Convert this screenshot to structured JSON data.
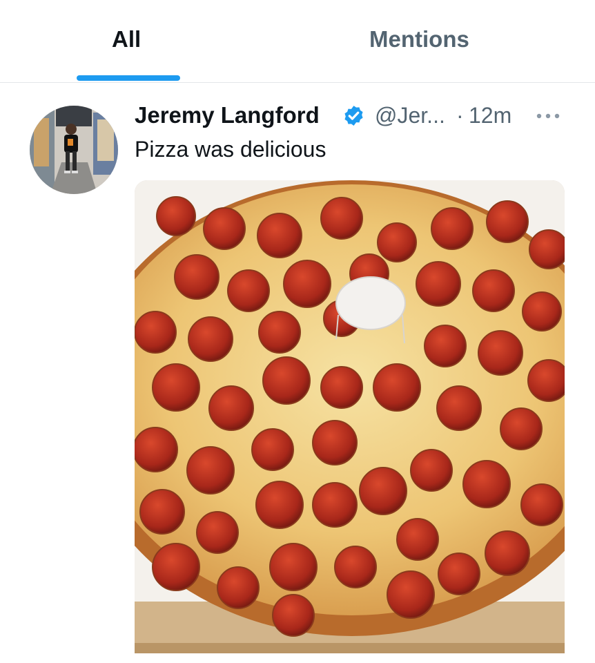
{
  "tabs": {
    "all_label": "All",
    "mentions_label": "Mentions",
    "active": "All",
    "accent_color": "#1d9bf0"
  },
  "tweet": {
    "author_name": "Jeremy Langford",
    "verified": true,
    "handle": "@Jer...",
    "separator": "·",
    "time": "12m",
    "text": "Pizza was delicious",
    "avatar_icon": "user-avatar",
    "more_icon": "more-horizontal-icon",
    "media_description_icon": "pizza-photo"
  }
}
